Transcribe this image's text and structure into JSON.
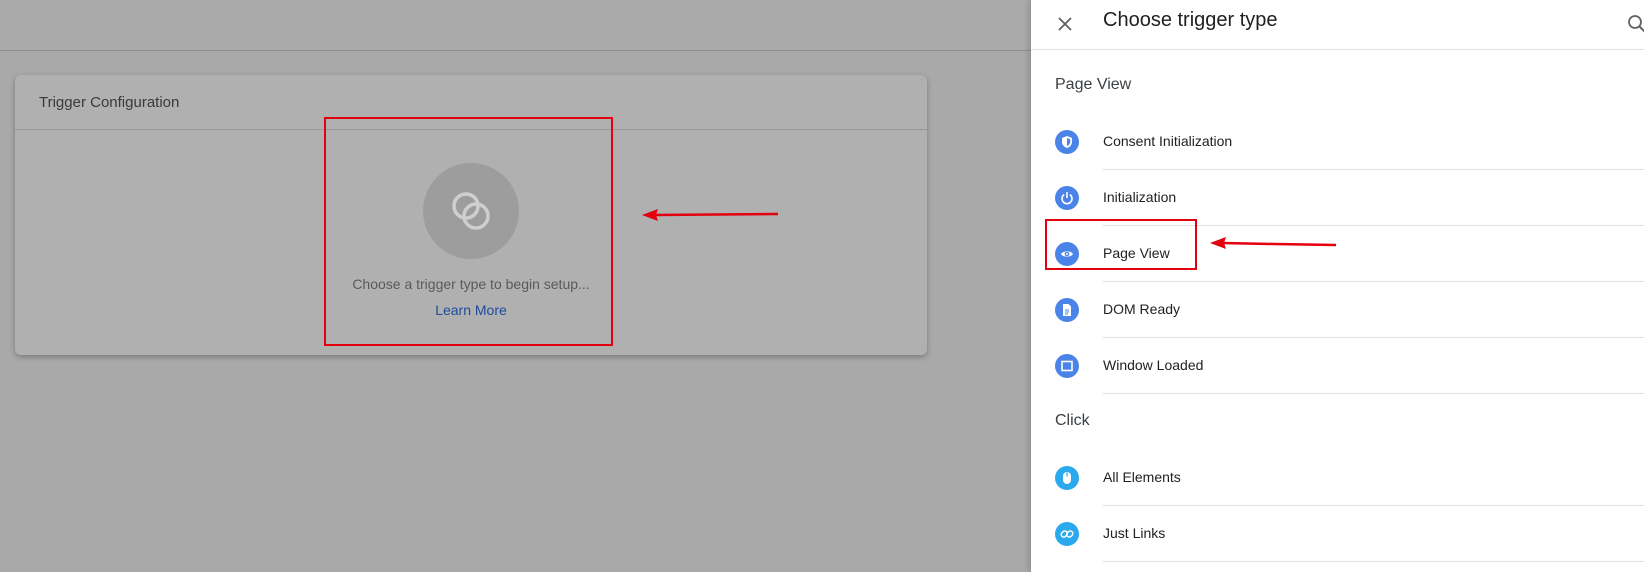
{
  "card": {
    "title": "Trigger Configuration",
    "hint": "Choose a trigger type to begin setup...",
    "learn_more": "Learn More"
  },
  "panel": {
    "title": "Choose trigger type",
    "sections": [
      {
        "title": "Page View",
        "items": [
          {
            "label": "Consent Initialization",
            "icon": "shield-icon"
          },
          {
            "label": "Initialization",
            "icon": "power-icon"
          },
          {
            "label": "Page View",
            "icon": "eye-icon"
          },
          {
            "label": "DOM Ready",
            "icon": "document-icon"
          },
          {
            "label": "Window Loaded",
            "icon": "window-icon"
          }
        ]
      },
      {
        "title": "Click",
        "items": [
          {
            "label": "All Elements",
            "icon": "mouse-icon"
          },
          {
            "label": "Just Links",
            "icon": "link-icon"
          }
        ]
      }
    ]
  },
  "colors": {
    "page_view_icon": "#4a84e8",
    "click_icon": "#2aa9ec",
    "highlight": "#e3000f",
    "link": "#1d4b9c"
  }
}
